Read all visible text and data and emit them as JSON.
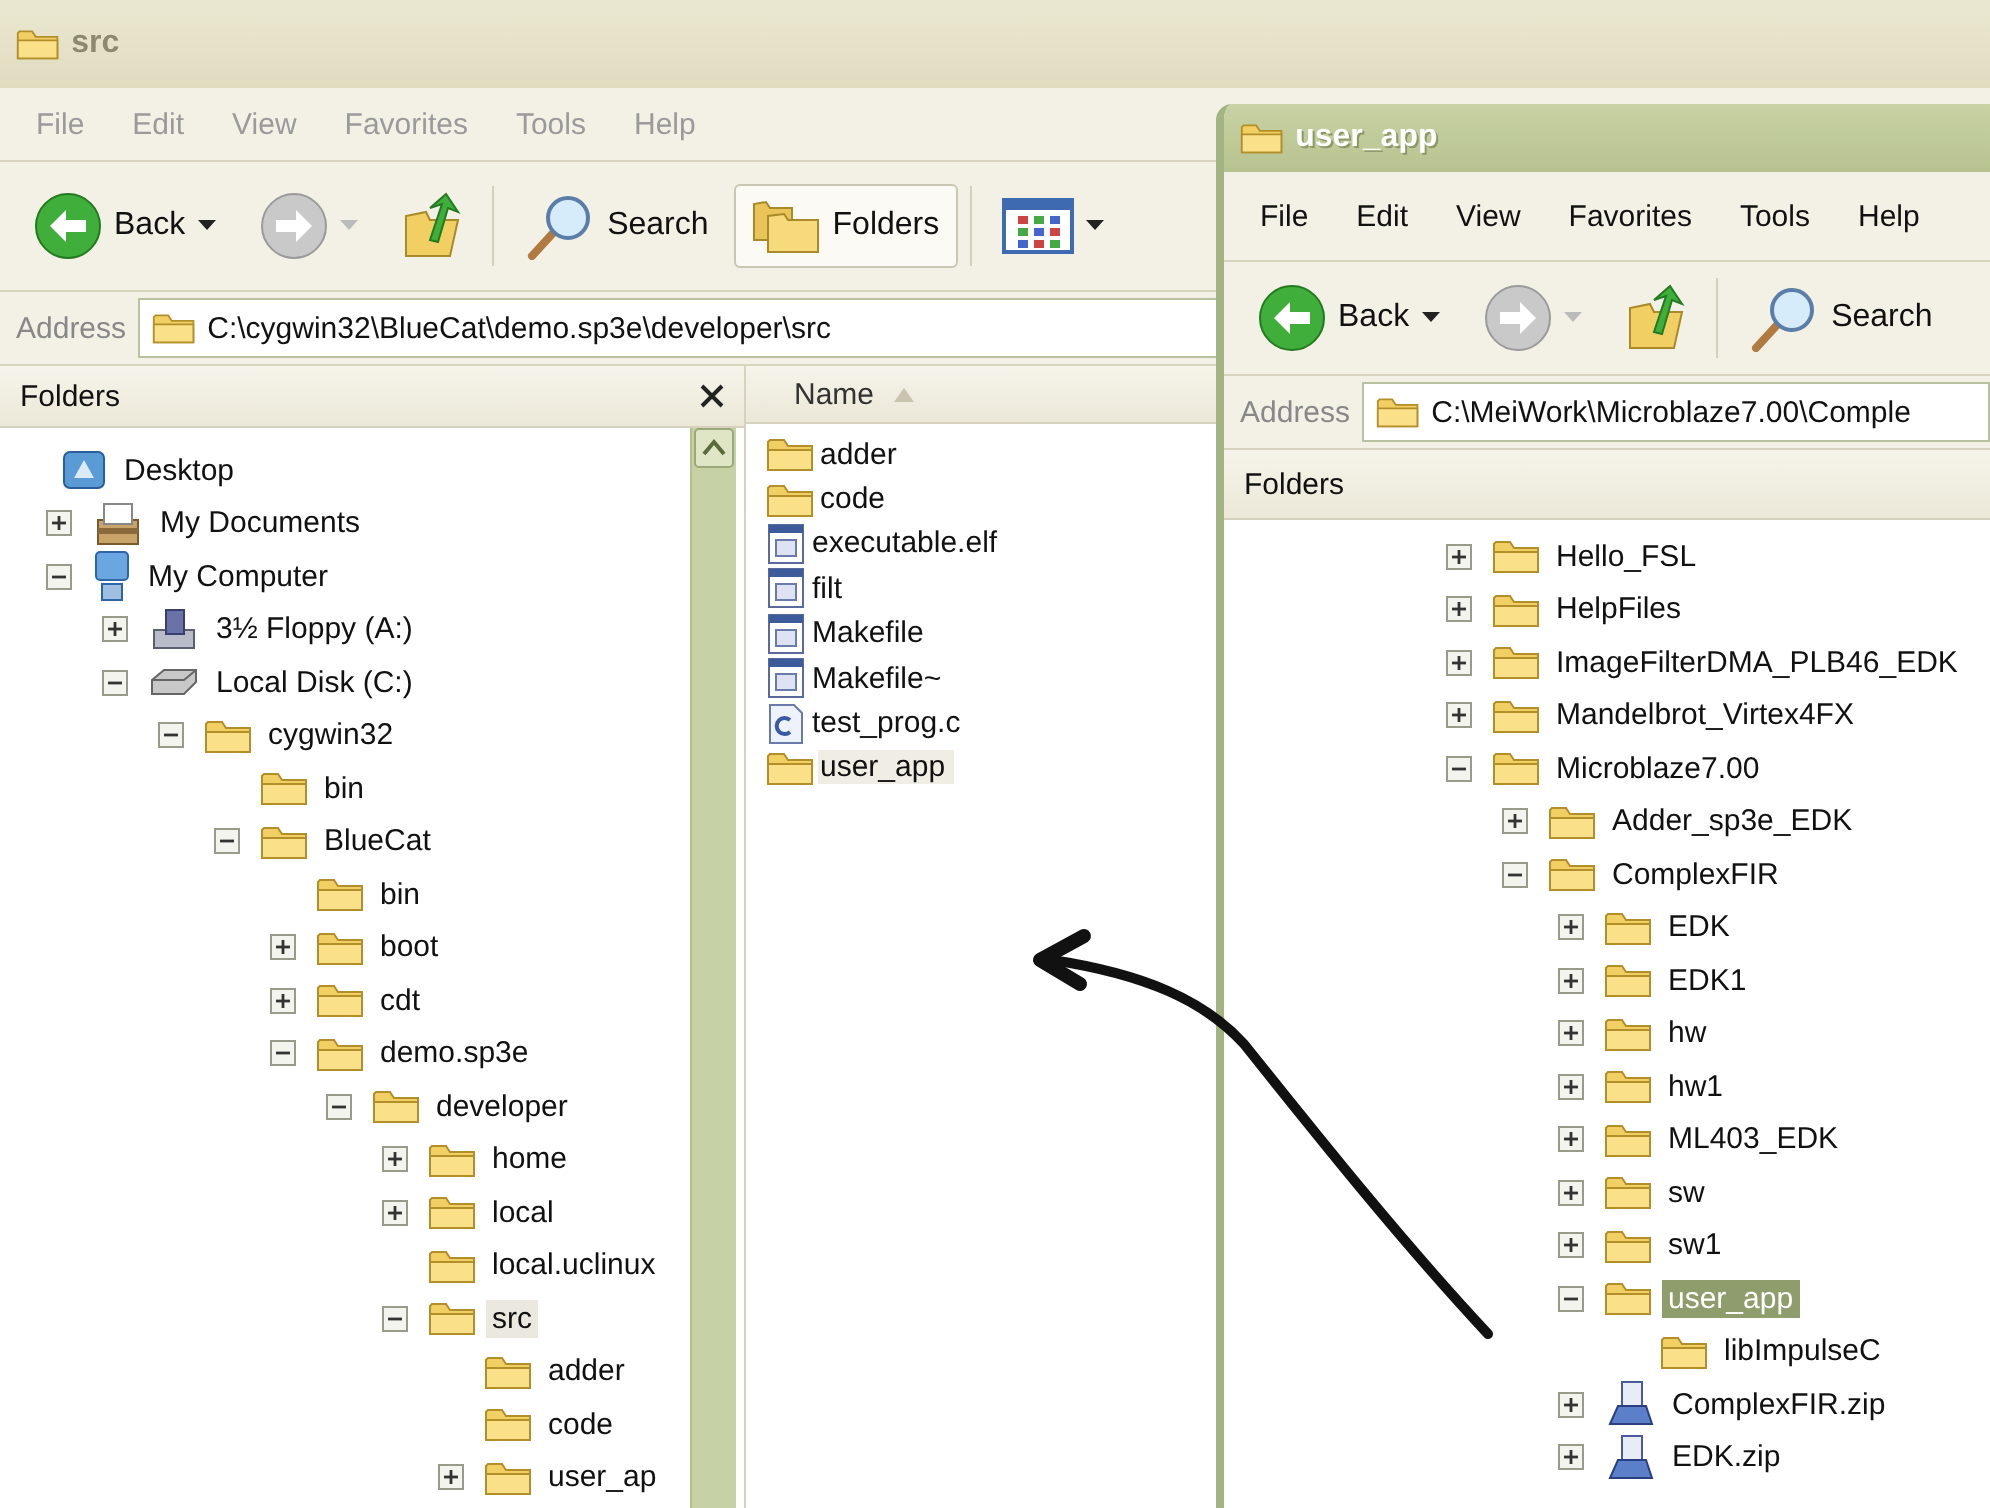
{
  "back_window": {
    "title": "src",
    "active": false,
    "menu": [
      "File",
      "Edit",
      "View",
      "Favorites",
      "Tools",
      "Help"
    ],
    "toolbar": [
      {
        "kind": "back",
        "label": "Back",
        "dropdown": true,
        "disabled": false,
        "selected": false
      },
      {
        "kind": "forward",
        "dropdown": true,
        "disabled": true,
        "selected": false
      },
      {
        "kind": "up",
        "dropdown": false,
        "disabled": false,
        "selected": false
      },
      {
        "kind": "search",
        "label": "Search",
        "dropdown": false,
        "disabled": false,
        "selected": false
      },
      {
        "kind": "folders",
        "label": "Folders",
        "dropdown": false,
        "disabled": false,
        "selected": true
      },
      {
        "kind": "views",
        "dropdown": true,
        "disabled": false,
        "selected": false
      }
    ],
    "address": {
      "label": "Address",
      "value": "C:\\cygwin32\\BlueCat\\demo.sp3e\\developer\\src"
    },
    "folders_pane": {
      "title": "Folders",
      "tree": [
        {
          "label": "Desktop",
          "kind": "desktop",
          "selected": false,
          "children": [
            {
              "label": "My Documents",
              "kind": "documents",
              "expanded": false,
              "selected": false
            },
            {
              "label": "My Computer",
              "kind": "computer",
              "expanded": true,
              "selected": false,
              "children": [
                {
                  "label": "3½ Floppy (A:)",
                  "kind": "floppy",
                  "expanded": false,
                  "selected": false
                },
                {
                  "label": "Local Disk (C:)",
                  "kind": "disk",
                  "expanded": true,
                  "selected": false,
                  "children": [
                    {
                      "label": "cygwin32",
                      "kind": "folder",
                      "expanded": true,
                      "selected": false,
                      "children": [
                        {
                          "label": "bin",
                          "kind": "folder",
                          "selected": false
                        },
                        {
                          "label": "BlueCat",
                          "kind": "folder",
                          "expanded": true,
                          "selected": false,
                          "children": [
                            {
                              "label": "bin",
                              "kind": "folder",
                              "selected": false
                            },
                            {
                              "label": "boot",
                              "kind": "folder",
                              "expanded": false,
                              "selected": false
                            },
                            {
                              "label": "cdt",
                              "kind": "folder",
                              "expanded": false,
                              "selected": false
                            },
                            {
                              "label": "demo.sp3e",
                              "kind": "folder",
                              "expanded": true,
                              "selected": false,
                              "children": [
                                {
                                  "label": "developer",
                                  "kind": "folder",
                                  "expanded": true,
                                  "selected": false,
                                  "children": [
                                    {
                                      "label": "home",
                                      "kind": "folder",
                                      "expanded": false,
                                      "selected": false
                                    },
                                    {
                                      "label": "local",
                                      "kind": "folder",
                                      "expanded": false,
                                      "selected": false
                                    },
                                    {
                                      "label": "local.uclinux",
                                      "kind": "folder",
                                      "selected": false
                                    },
                                    {
                                      "label": "src",
                                      "kind": "folder",
                                      "expanded": true,
                                      "selected": true,
                                      "children": [
                                        {
                                          "label": "adder",
                                          "kind": "folder",
                                          "selected": false
                                        },
                                        {
                                          "label": "code",
                                          "kind": "folder",
                                          "selected": false
                                        },
                                        {
                                          "label": "user_ap",
                                          "kind": "folder",
                                          "expanded": false,
                                          "selected": false
                                        }
                                      ]
                                    }
                                  ]
                                }
                              ]
                            }
                          ]
                        }
                      ]
                    }
                  ]
                }
              ]
            }
          ]
        }
      ]
    },
    "file_list": {
      "column": "Name",
      "items": [
        {
          "name": "adder",
          "kind": "folder",
          "selected": false
        },
        {
          "name": "code",
          "kind": "folder",
          "selected": false
        },
        {
          "name": "executable.elf",
          "kind": "file",
          "selected": false
        },
        {
          "name": "filt",
          "kind": "file",
          "selected": false
        },
        {
          "name": "Makefile",
          "kind": "file",
          "selected": false
        },
        {
          "name": "Makefile~",
          "kind": "file",
          "selected": false
        },
        {
          "name": "test_prog.c",
          "kind": "c_file",
          "selected": false
        },
        {
          "name": "user_app",
          "kind": "folder",
          "selected": true
        }
      ]
    }
  },
  "front_window": {
    "title": "user_app",
    "active": true,
    "menu": [
      "File",
      "Edit",
      "View",
      "Favorites",
      "Tools",
      "Help"
    ],
    "toolbar": [
      {
        "kind": "back",
        "label": "Back",
        "dropdown": true,
        "disabled": false,
        "selected": false
      },
      {
        "kind": "forward",
        "dropdown": true,
        "disabled": true,
        "selected": false
      },
      {
        "kind": "up",
        "dropdown": false,
        "disabled": false,
        "selected": false
      },
      {
        "kind": "search",
        "label": "Search",
        "dropdown": false,
        "disabled": false,
        "selected": false
      }
    ],
    "address": {
      "label": "Address",
      "value": "C:\\MeiWork\\Microblaze7.00\\Comple"
    },
    "folders_pane": {
      "title": "Folders",
      "tree": [
        {
          "label": "Hello_FSL",
          "kind": "folder",
          "expanded": false,
          "selected": false
        },
        {
          "label": "HelpFiles",
          "kind": "folder",
          "expanded": false,
          "selected": false
        },
        {
          "label": "ImageFilterDMA_PLB46_EDK",
          "kind": "folder",
          "expanded": false,
          "selected": false
        },
        {
          "label": "Mandelbrot_Virtex4FX",
          "kind": "folder",
          "expanded": false,
          "selected": false
        },
        {
          "label": "Microblaze7.00",
          "kind": "folder",
          "expanded": true,
          "selected": false,
          "children": [
            {
              "label": "Adder_sp3e_EDK",
              "kind": "folder",
              "expanded": false,
              "selected": false
            },
            {
              "label": "ComplexFIR",
              "kind": "folder",
              "expanded": true,
              "selected": false,
              "children": [
                {
                  "label": "EDK",
                  "kind": "folder",
                  "expanded": false,
                  "selected": false
                },
                {
                  "label": "EDK1",
                  "kind": "folder",
                  "expanded": false,
                  "selected": false
                },
                {
                  "label": "hw",
                  "kind": "folder",
                  "expanded": false,
                  "selected": false
                },
                {
                  "label": "hw1",
                  "kind": "folder",
                  "expanded": false,
                  "selected": false
                },
                {
                  "label": "ML403_EDK",
                  "kind": "folder",
                  "expanded": false,
                  "selected": false
                },
                {
                  "label": "sw",
                  "kind": "folder",
                  "expanded": false,
                  "selected": false
                },
                {
                  "label": "sw1",
                  "kind": "folder",
                  "expanded": false,
                  "selected": false
                },
                {
                  "label": "user_app",
                  "kind": "folder",
                  "expanded": true,
                  "selected": true,
                  "children": [
                    {
                      "label": "libImpulseC",
                      "kind": "folder",
                      "selected": false
                    }
                  ]
                },
                {
                  "label": "ComplexFIR.zip",
                  "kind": "zip",
                  "expanded": false,
                  "selected": false
                },
                {
                  "label": "EDK.zip",
                  "kind": "zip",
                  "expanded": false,
                  "selected": false
                }
              ]
            }
          ]
        }
      ]
    }
  }
}
